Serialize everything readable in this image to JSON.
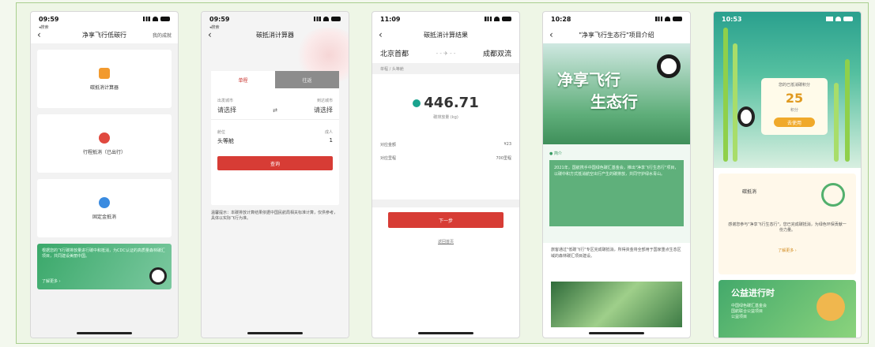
{
  "phones": [
    {
      "time": "09:59",
      "sub": "◂搜索",
      "title": "净享飞行低碳行",
      "right": "我的成就",
      "cards": [
        "碳抵消计算器",
        "行程抵消（已出行）",
        "固定金抵消"
      ],
      "banner": "根据您的飞行碳排放量进行碳中和抵消，为CDC认证的高质量森林碳汇项目，共同建设美丽中国。",
      "banner_more": "了解更多 ›"
    },
    {
      "time": "09:59",
      "sub": "◂搜索",
      "title": "碳抵消计算器",
      "tab_on": "单程",
      "tab_off": "往返",
      "from_label": "出发城市",
      "to_label": "到达城市",
      "from_value": "请选择",
      "to_value": "请选择",
      "cabin_label": "舱位",
      "pax_label": "成人",
      "cabin_value": "头等舱",
      "pax_value": "1",
      "query": "查询",
      "tip": "温馨提示：本碳排放计算结果依据中国民航局相关标准计算，仅供参考，具体以实际飞行为准。"
    },
    {
      "time": "11:09",
      "title": "碳抵消计算结果",
      "from": "北京首都",
      "to": "成都双流",
      "plane": "- - ✈ - -",
      "section": "单程 / 头等舱",
      "value": "446.71",
      "unit": "碳排放量 (kg)",
      "k1": "对应金额",
      "v1": "¥23",
      "k2": "对应里程",
      "v2": "700里程",
      "next": "下一步",
      "link": "返回首页"
    },
    {
      "time": "10:28",
      "title": "\"净享飞行生态行\"项目介绍",
      "hero1": "净享飞行",
      "hero2": "生态行",
      "label": "● 简介",
      "desc": "2021年，国航携手中国绿色碳汇基金会，推出\"净享飞行生态行\"项目，以碳中和方式抵消航空出行产生的碳排放，共同守护绿水青山。",
      "text": "旅客通过\"低碳飞行\"专区完成碳抵消，所得资金将全部用于国家重点生态区域的森林碳汇项目建设。"
    },
    {
      "time": "10:53",
      "coupon_title": "您的已抵消碳积分",
      "coupon_num": "25",
      "coupon_sub": "积分",
      "coupon_btn": "去使用",
      "card_name": "碳抵消",
      "card_note": "感谢您参与\"净享飞行生态行\"，您已完成碳抵消，为绿色环保贡献一份力量。",
      "card_link": "了解更多 ›",
      "welfare_title": "公益进行时",
      "welfare_sub": "中国绿色碳汇基金会\n国航联合公益项目\n公益项目"
    }
  ]
}
